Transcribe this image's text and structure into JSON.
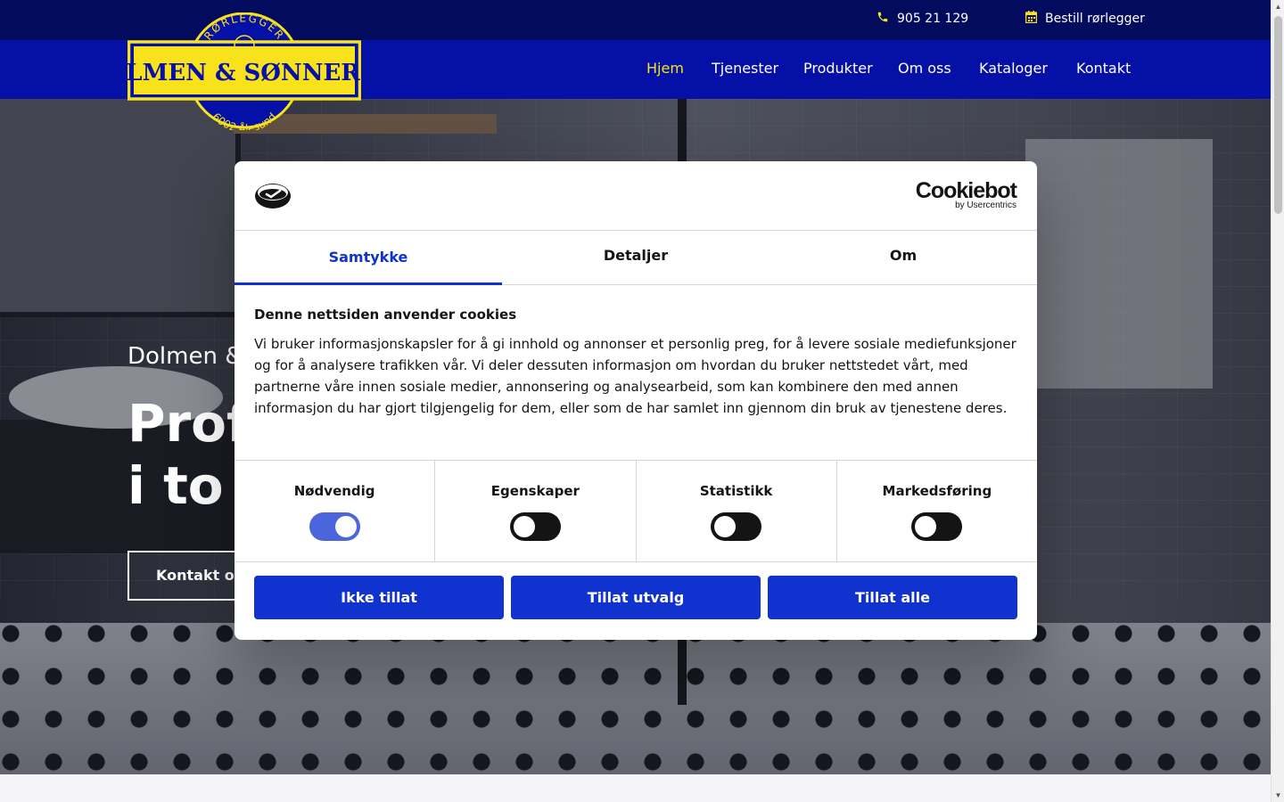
{
  "topbar": {
    "phone": "905 21 129",
    "book": "Bestill rørlegger"
  },
  "logo": {
    "top_text": "RØRLEGGER",
    "name": "DOLMEN & SØNNER AS",
    "bottom_text": "6002 Ålesund"
  },
  "nav": {
    "items": [
      {
        "label": "Hjem",
        "active": true
      },
      {
        "label": "Tjenester",
        "active": false
      },
      {
        "label": "Produkter",
        "active": false
      },
      {
        "label": "Om oss",
        "active": false
      },
      {
        "label": "Kataloger",
        "active": false
      },
      {
        "label": "Kontakt",
        "active": false
      }
    ]
  },
  "hero": {
    "subtitle": "Dolmen &",
    "title_line1": "Profe",
    "title_line2": "i to g",
    "button": "Kontakt os"
  },
  "cookie": {
    "brand": "Cookiebot",
    "brand_by": "by Usercentrics",
    "tabs": [
      "Samtykke",
      "Detaljer",
      "Om"
    ],
    "heading": "Denne nettsiden anvender cookies",
    "body": "Vi bruker informasjonskapsler for å gi innhold og annonser et personlig preg, for å levere sosiale mediefunksjoner og for å analysere trafikken vår. Vi deler dessuten informasjon om hvordan du bruker nettstedet vårt, med partnerne våre innen sosiale medier, annonsering og analysearbeid, som kan kombinere den med annen informasjon du har gjort tilgjengelig for dem, eller som de har samlet inn gjennom din bruk av tjenestene deres.",
    "toggles": [
      {
        "label": "Nødvendig",
        "on": true
      },
      {
        "label": "Egenskaper",
        "on": false
      },
      {
        "label": "Statistikk",
        "on": false
      },
      {
        "label": "Markedsføring",
        "on": false
      }
    ],
    "buttons": [
      "Ikke tillat",
      "Tillat utvalg",
      "Tillat alle"
    ]
  },
  "colors": {
    "topbar": "#020b5e",
    "navbar": "#0510a6",
    "accent_yellow": "#f7e21c",
    "cookie_blue": "#1032cf"
  },
  "icons": {
    "phone": "phone-icon",
    "calendar": "calendar-icon"
  }
}
